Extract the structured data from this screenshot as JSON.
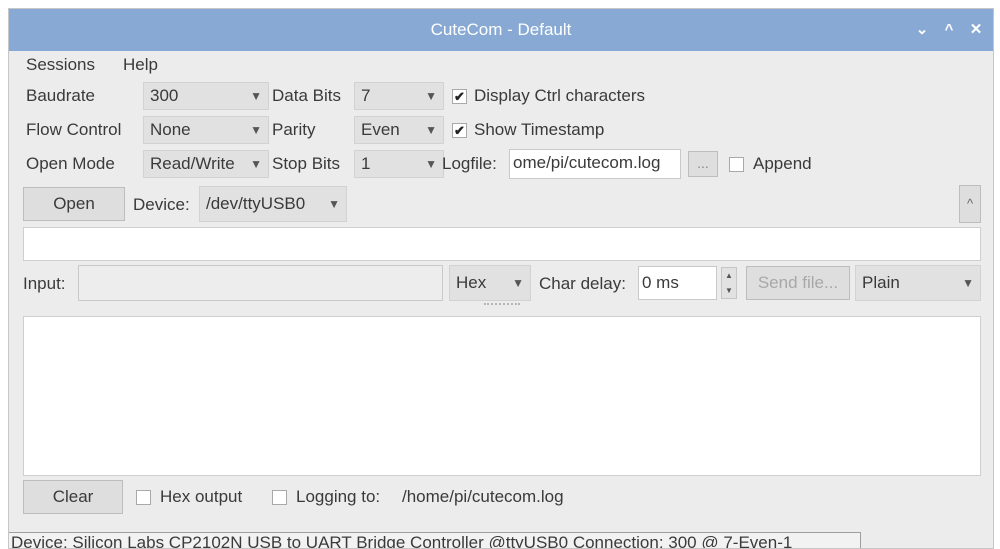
{
  "window": {
    "title": "CuteCom - Default",
    "controls": [
      "⌄",
      "^",
      "✕"
    ]
  },
  "menu": [
    "Sessions",
    "Help"
  ],
  "settings": {
    "baudrate_label": "Baudrate",
    "baudrate_value": "300",
    "flow_control_label": "Flow Control",
    "flow_control_value": "None",
    "open_mode_label": "Open Mode",
    "open_mode_value": "Read/Write",
    "data_bits_label": "Data Bits",
    "data_bits_value": "7",
    "parity_label": "Parity",
    "parity_value": "Even",
    "stop_bits_label": "Stop Bits",
    "stop_bits_value": "1",
    "display_ctrl_label": "Display Ctrl characters",
    "display_ctrl_checked": true,
    "show_timestamp_label": "Show Timestamp",
    "show_timestamp_checked": true,
    "logfile_label": "Logfile:",
    "logfile_value": "ome/pi/cutecom.log",
    "browse_label": "...",
    "append_label": "Append",
    "append_checked": false
  },
  "device_row": {
    "open_label": "Open",
    "device_label": "Device:",
    "device_value": "/dev/ttyUSB0",
    "collapse_label": "^"
  },
  "input_row": {
    "input_label": "Input:",
    "input_value": "",
    "format_value": "Hex",
    "char_delay_label": "Char delay:",
    "char_delay_value": "0 ms",
    "send_file_label": "Send file...",
    "protocol_value": "Plain"
  },
  "output_row": {
    "clear_label": "Clear",
    "hex_output_label": "Hex output",
    "hex_output_checked": false,
    "logging_label": "Logging to:",
    "logging_checked": false,
    "logging_path": "/home/pi/cutecom.log"
  },
  "status": "Device: Silicon Labs CP2102N USB to UART Bridge Controller @ttyUSB0  Connection: 300 @ 7-Even-1"
}
